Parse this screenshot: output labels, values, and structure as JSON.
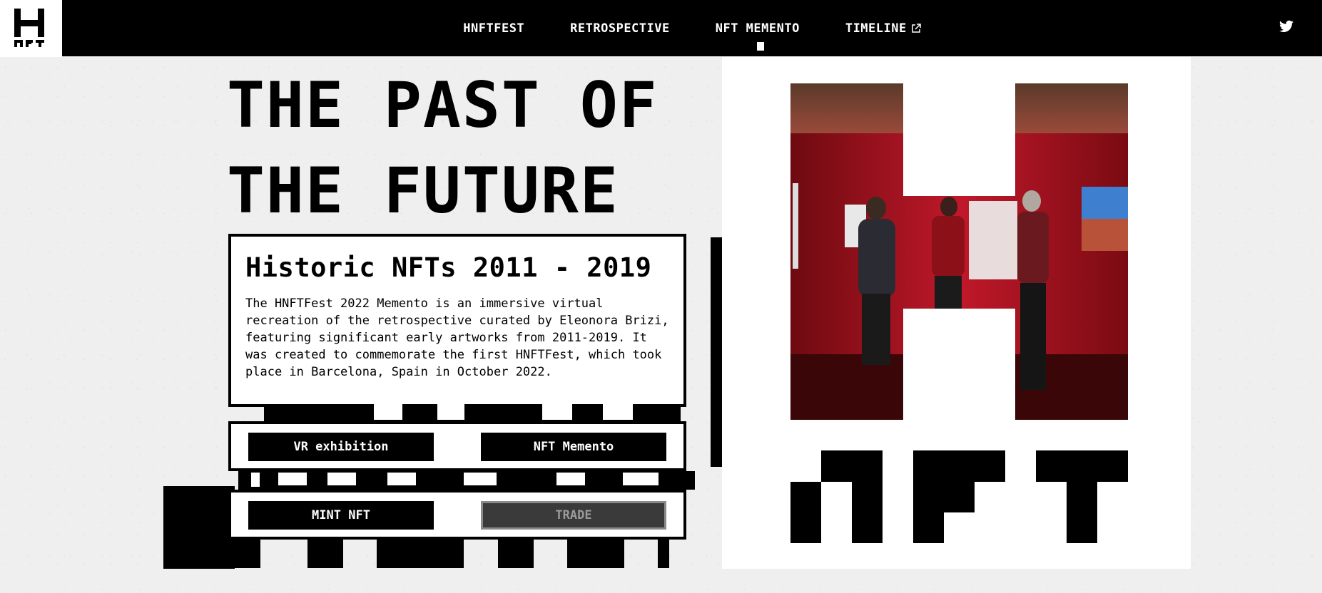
{
  "nav": {
    "items": [
      {
        "label": "HNFTFEST"
      },
      {
        "label": "RETROSPECTIVE"
      },
      {
        "label": "NFT MEMENTO"
      },
      {
        "label": "TIMELINE"
      }
    ],
    "active_index": 2,
    "timeline_icon": "external-link-icon",
    "social_icon": "twitter-icon"
  },
  "logo": {
    "letter": "H",
    "sub": "NFT"
  },
  "hero": {
    "title_line1": "THE PAST OF",
    "title_line2": "THE FUTURE"
  },
  "card": {
    "heading": "Historic NFTs 2011 - 2019",
    "body": "The HNFTFest 2022 Memento is an immersive virtual recreation of the retrospective curated by Eleonora Brizi, featuring significant early artworks from 2011-2019. It was created to commemorate the first HNFTFest, which took place in Barcelona, Spain in October 2022."
  },
  "buttons": {
    "vr": "VR exhibition",
    "memento": "NFT Memento",
    "mint": "MINT NFT",
    "trade": "TRADE"
  },
  "colors": {
    "background": "#efefef",
    "ink": "#000000",
    "paper": "#ffffff",
    "photo_red": "#b0141e"
  }
}
